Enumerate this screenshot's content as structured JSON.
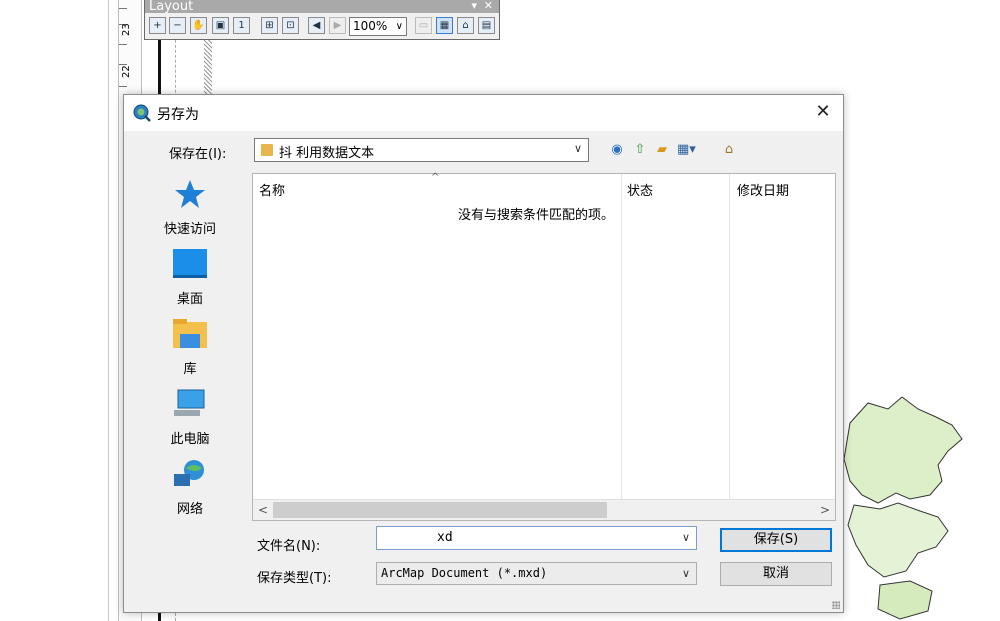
{
  "toolbar": {
    "title": "Layout",
    "zoom_value": "100%",
    "buttons": [
      "zoom-in-icon",
      "zoom-out-icon",
      "pan-icon",
      "zoom-whole-page-icon",
      "zoom-100-icon",
      "fixed-zoom-in-icon",
      "fixed-zoom-out-icon",
      "go-back-extent-icon",
      "go-forward-extent-icon",
      "toggle-draft-mode-icon",
      "focus-data-frame-icon",
      "change-layout-icon",
      "data-driven-pages-icon"
    ]
  },
  "ruler": {
    "labels": [
      "23",
      "22"
    ]
  },
  "dialog": {
    "title": "另存为",
    "close": "✕",
    "look_in_label": "保存在(I):",
    "look_in_value": "抖      利用数据文本",
    "places": [
      {
        "label": "快速访问",
        "icon": "quick-access-star-icon"
      },
      {
        "label": "桌面",
        "icon": "desktop-icon"
      },
      {
        "label": "库",
        "icon": "libraries-icon"
      },
      {
        "label": "此电脑",
        "icon": "this-pc-icon"
      },
      {
        "label": "网络",
        "icon": "network-icon"
      }
    ],
    "columns": [
      "名称",
      "状态",
      "修改日期"
    ],
    "empty_message": "没有与搜索条件匹配的项。",
    "file_name_label": "文件名(N):",
    "file_name_value": "xd",
    "file_type_label": "保存类型(T):",
    "file_type_value": "ArcMap Document (*.mxd)",
    "save_button": "保存(S)",
    "cancel_button": "取消"
  },
  "colors": {
    "accent": "#0078d7",
    "folder": "#e8b64c",
    "map_fill": "#dcefc9"
  }
}
